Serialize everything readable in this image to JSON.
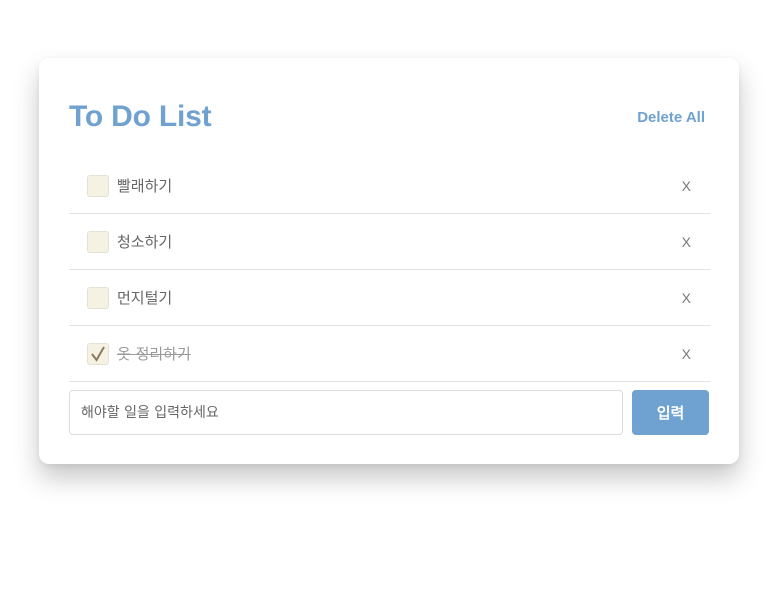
{
  "header": {
    "title": "To Do List",
    "delete_all_label": "Delete All"
  },
  "todos": [
    {
      "text": "빨래하기",
      "checked": false,
      "remove_label": "X"
    },
    {
      "text": "청소하기",
      "checked": false,
      "remove_label": "X"
    },
    {
      "text": "먼지털기",
      "checked": false,
      "remove_label": "X"
    },
    {
      "text": "옷 정리하기",
      "checked": true,
      "remove_label": "X"
    }
  ],
  "input": {
    "value": "",
    "placeholder": "해야할 일을 입력하세요",
    "submit_label": "입력"
  },
  "colors": {
    "accent": "#6fa2d1",
    "checkbox_bg": "#f5f1e3",
    "checkmark": "#8a7a5a",
    "divider": "#e2e2e2"
  },
  "icons": {
    "checkbox_mark": "checkmark-icon"
  }
}
